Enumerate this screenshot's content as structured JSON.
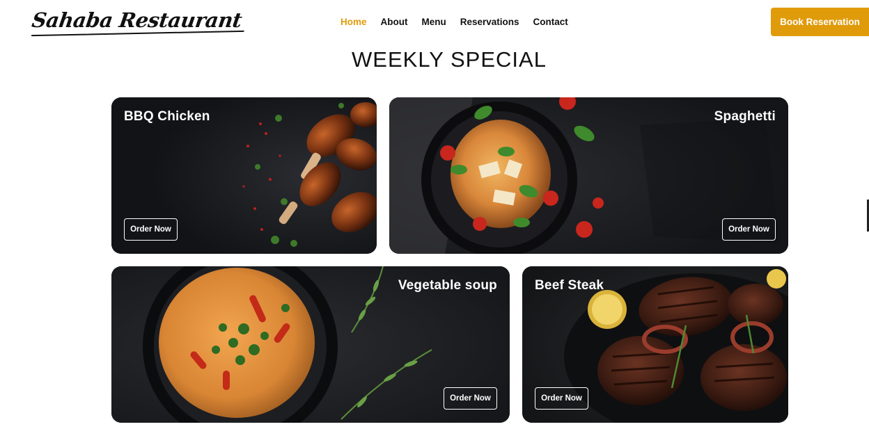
{
  "brand": {
    "logo_text": "Sahaba Restaurant"
  },
  "nav": {
    "items": [
      {
        "label": "Home",
        "active": true
      },
      {
        "label": "About"
      },
      {
        "label": "Menu"
      },
      {
        "label": "Reservations"
      },
      {
        "label": "Contact"
      }
    ]
  },
  "header": {
    "cta_label": "Book Reservation",
    "accent_color": "#e09b0b"
  },
  "section": {
    "title": "WEEKLY SPECIAL"
  },
  "cards": [
    {
      "title": "BBQ Chicken",
      "button": "Order Now"
    },
    {
      "title": "Spaghetti",
      "button": "Order Now"
    },
    {
      "title": "Vegetable soup",
      "button": "Order Now"
    },
    {
      "title": "Beef Steak",
      "button": "Order Now"
    }
  ]
}
